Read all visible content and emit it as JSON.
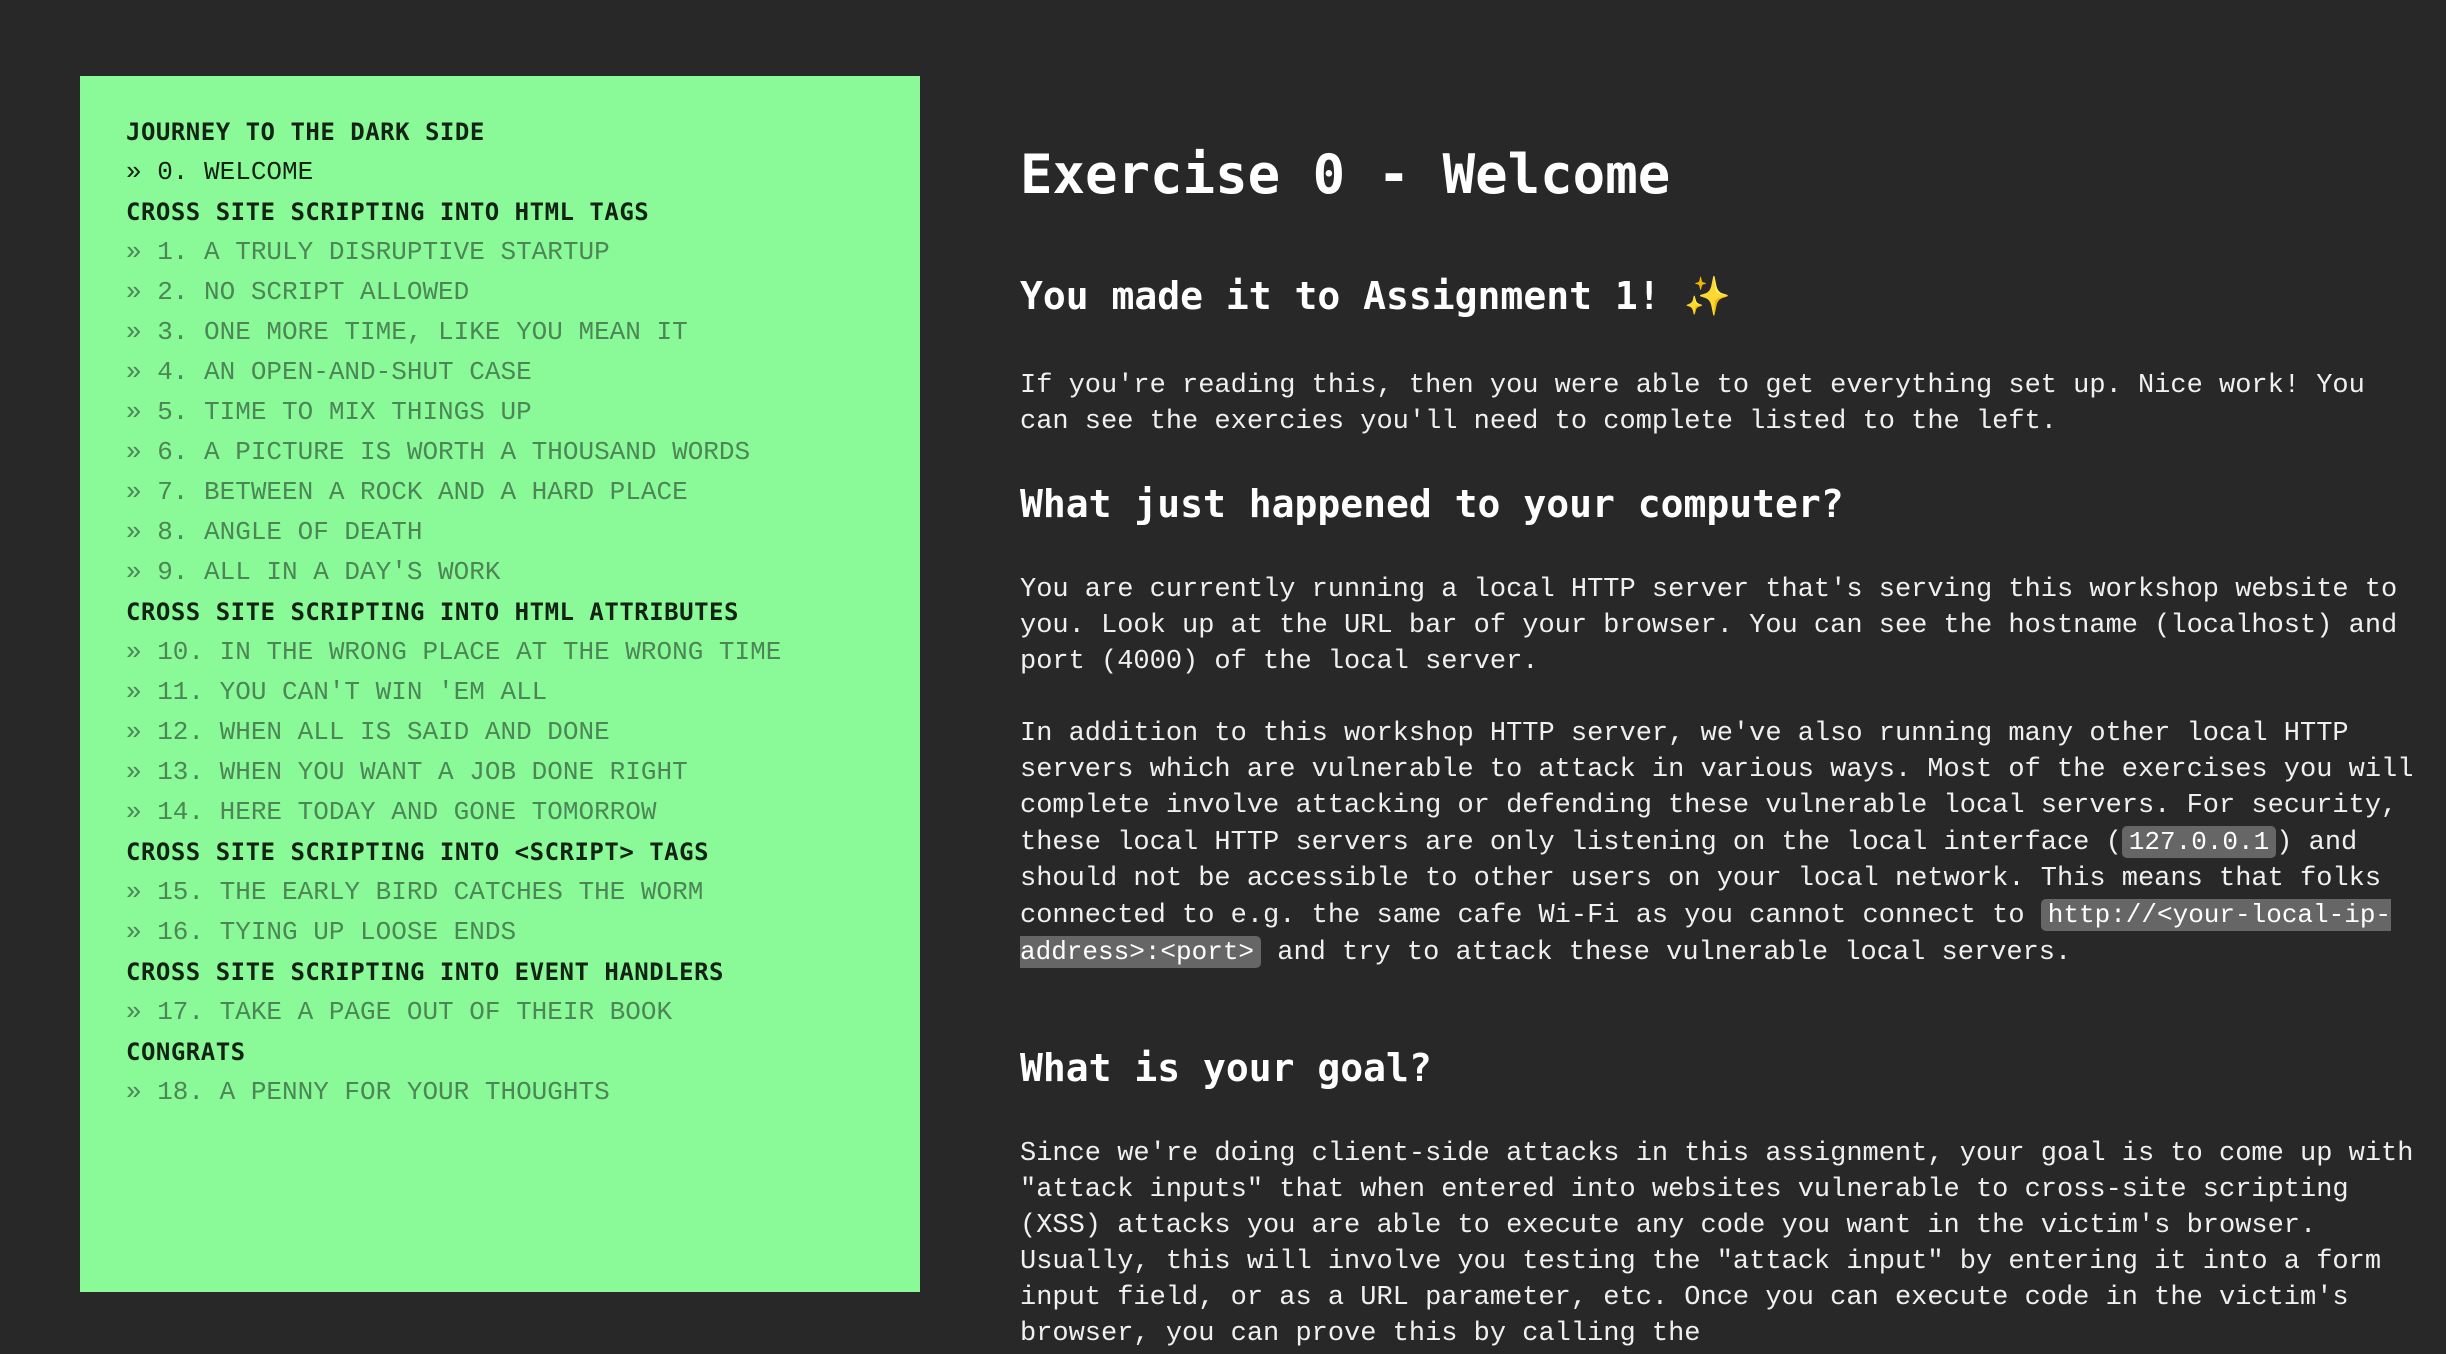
{
  "sidebar": {
    "title": "JOURNEY TO THE DARK SIDE",
    "welcome": "» 0. WELCOME",
    "sections": [
      {
        "heading": "CROSS SITE SCRIPTING INTO HTML TAGS",
        "items": [
          "» 1. A TRULY DISRUPTIVE STARTUP",
          "» 2. NO SCRIPT ALLOWED",
          "» 3. ONE MORE TIME, LIKE YOU MEAN IT",
          "» 4. AN OPEN-AND-SHUT CASE",
          "» 5. TIME TO MIX THINGS UP",
          "» 6. A PICTURE IS WORTH A THOUSAND WORDS",
          "» 7. BETWEEN A ROCK AND A HARD PLACE",
          "» 8. ANGLE OF DEATH",
          "» 9. ALL IN A DAY'S WORK"
        ]
      },
      {
        "heading": "CROSS SITE SCRIPTING INTO HTML ATTRIBUTES",
        "items": [
          "» 10. IN THE WRONG PLACE AT THE WRONG TIME",
          "» 11. YOU CAN'T WIN 'EM ALL",
          "» 12. WHEN ALL IS SAID AND DONE",
          "» 13. WHEN YOU WANT A JOB DONE RIGHT",
          "» 14. HERE TODAY AND GONE TOMORROW"
        ]
      },
      {
        "heading": "CROSS SITE SCRIPTING INTO <SCRIPT> TAGS",
        "items": [
          "» 15. THE EARLY BIRD CATCHES THE WORM",
          "» 16. TYING UP LOOSE ENDS"
        ]
      },
      {
        "heading": "CROSS SITE SCRIPTING INTO EVENT HANDLERS",
        "items": [
          "» 17. TAKE A PAGE OUT OF THEIR BOOK"
        ]
      },
      {
        "heading": "CONGRATS",
        "items": [
          "» 18. A PENNY FOR YOUR THOUGHTS"
        ]
      }
    ]
  },
  "main": {
    "title": "Exercise 0 - Welcome",
    "subtitle": "You made it to Assignment 1!",
    "subtitle_emoji": "✨",
    "intro": "If you're reading this, then you were able to get everything set up. Nice work! You can see the exercies you'll need to complete listed to the left.",
    "section2": {
      "heading": "What just happened to your computer?",
      "para1": "You are currently running a local HTTP server that's serving this workshop website to you. Look up at the URL bar of your browser. You can see the hostname (localhost) and port (4000) of the local server.",
      "para2_a": "In addition to this workshop HTTP server, we've also running many other local HTTP servers which are vulnerable to attack in various ways. Most of the exercises you will complete involve attacking or defending these vulnerable local servers. For security, these local HTTP servers are only listening on the local interface (",
      "para2_code1": "127.0.0.1",
      "para2_b": ") and should not be accessible to other users on your local network. This means that folks connected to e.g. the same cafe Wi-Fi as you cannot connect to ",
      "para2_code2": "http://<your-local-ip-address>:<port>",
      "para2_c": " and try to attack these vulnerable local servers."
    },
    "section3": {
      "heading": "What is your goal?",
      "para1": "Since we're doing client-side attacks in this assignment, your goal is to come up with \"attack inputs\" that when entered into websites vulnerable to cross-site scripting (XSS) attacks you are able to execute any code you want in the victim's browser. Usually, this will involve you testing the \"attack input\" by entering it into a form input field, or as a URL parameter, etc. Once you can execute code in the victim's browser, you can prove this by calling the"
    }
  }
}
